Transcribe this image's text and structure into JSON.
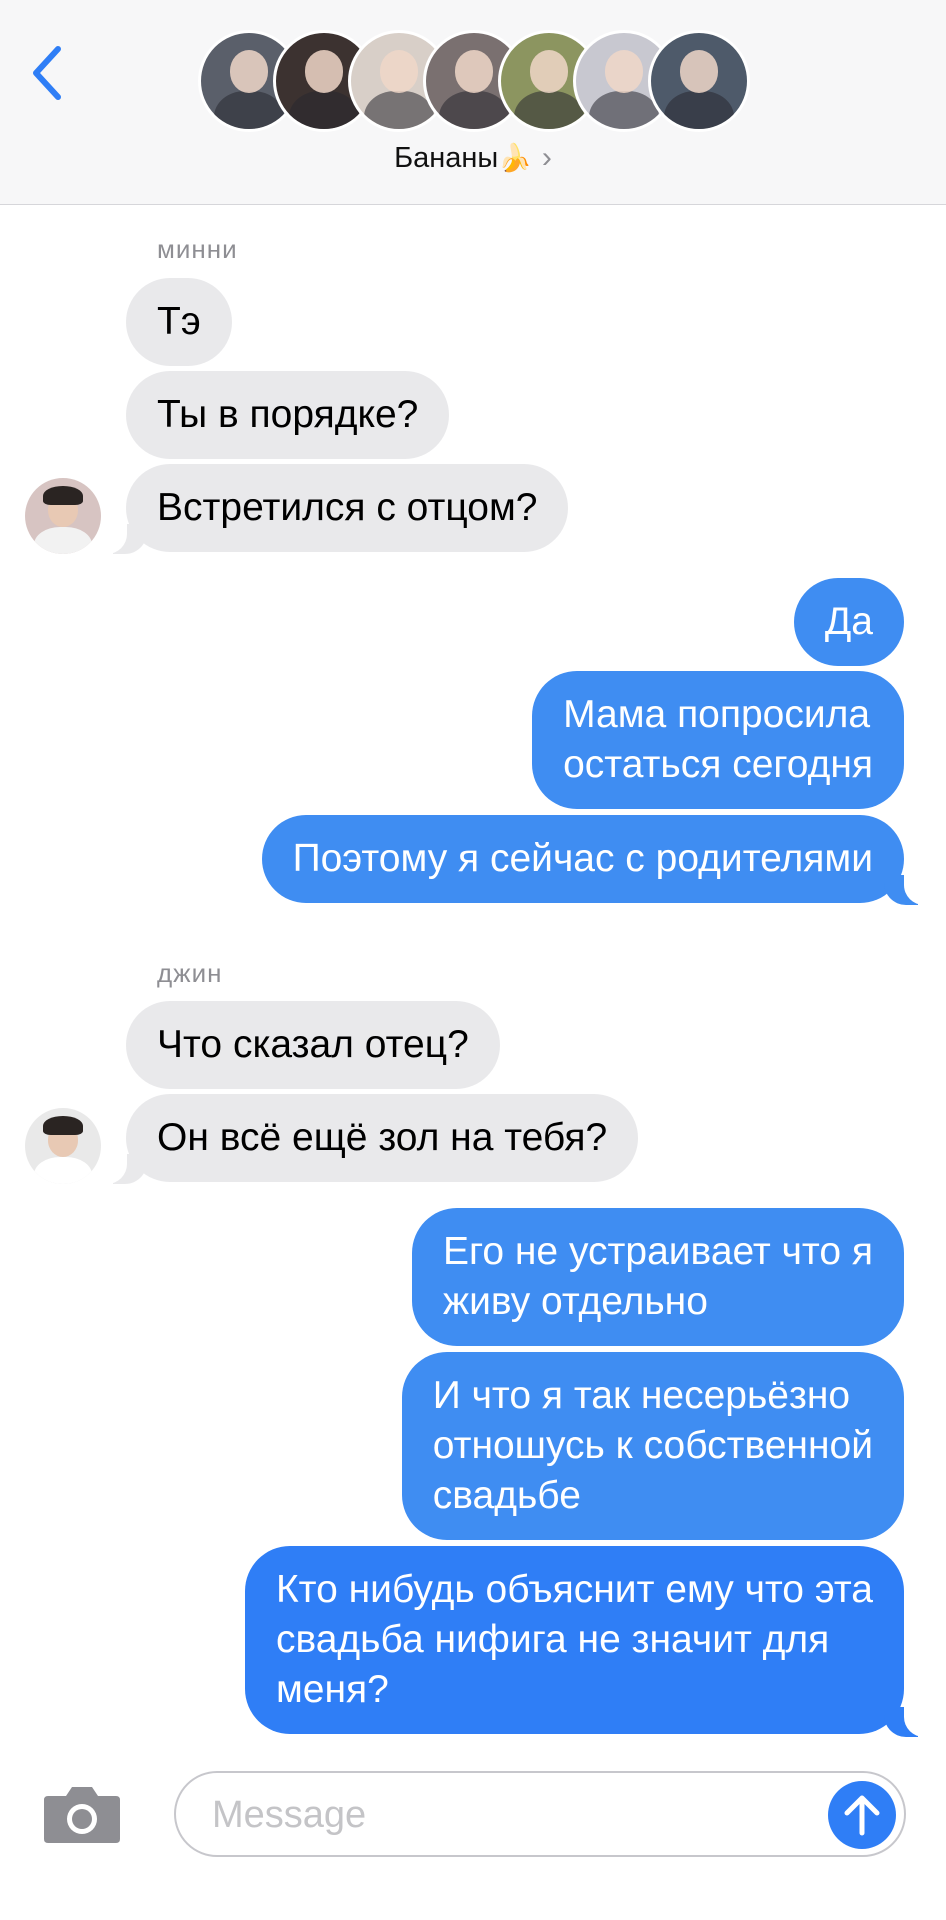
{
  "header": {
    "group_name": "Бананы",
    "group_emoji": "🍌",
    "back_icon": "chevron-left-icon",
    "info_icon": "chevron-right-icon",
    "participant_avatar_tones": [
      "#5a5f6a",
      "#3c3230",
      "#d8cfc8",
      "#7a7070",
      "#8c9560",
      "#c8c8d0",
      "#4e5a6a"
    ]
  },
  "conversation": [
    {
      "sender": "минни",
      "direction": "incoming",
      "avatar_tone": "#d7c4c2",
      "messages": [
        "Тэ",
        "Ты в порядке?",
        "Встретился с отцом?"
      ]
    },
    {
      "direction": "outgoing",
      "messages": [
        "Да",
        "Мама попросила\nостаться сегодня",
        "Поэтому я сейчас с родителями"
      ]
    },
    {
      "sender": "джин",
      "direction": "incoming",
      "avatar_tone": "#e9e9e9",
      "messages": [
        "Что сказал отец?",
        "Он всё ещё зол на тебя?"
      ]
    },
    {
      "direction": "outgoing",
      "messages": [
        "Его не устраивает что я\nживу отдельно",
        "И что я так несерьёзно\nотношусь к собственной\nсвадьбе",
        "Кто нибудь объяснит ему что эта\nсвадьба нифига не значит для\nменя?"
      ]
    }
  ],
  "input": {
    "placeholder": "Message",
    "value": "",
    "camera_icon": "camera-icon",
    "send_icon": "arrow-up-icon"
  },
  "colors": {
    "incoming_bubble": "#e9e9eb",
    "outgoing_bubble": "#3f8df2",
    "outgoing_bubble_recent": "#2f7ef6",
    "accent": "#2f7ef6"
  }
}
